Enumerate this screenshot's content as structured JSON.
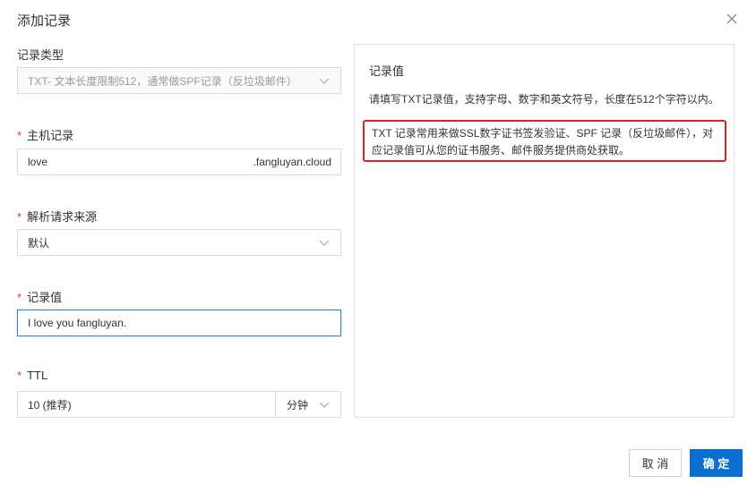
{
  "dialog": {
    "title": "添加记录"
  },
  "form": {
    "record_type": {
      "label": "记录类型",
      "value": "TXT- 文本长度限制512，通常做SPF记录（反垃圾邮件）"
    },
    "host": {
      "label": "主机记录",
      "value": "love",
      "suffix": ".fangluyan.cloud"
    },
    "line": {
      "label": "解析请求来源",
      "value": "默认"
    },
    "record_value": {
      "label": "记录值",
      "value": "I love you fangluyan."
    },
    "ttl": {
      "label": "TTL",
      "value": "10 (推荐)",
      "unit": "分钟"
    }
  },
  "help": {
    "title": "记录值",
    "line1": "请填写TXT记录值，支持字母、数字和英文符号，长度在512个字符以内。",
    "highlight": "TXT 记录常用来做SSL数字证书签发验证、SPF 记录（反垃圾邮件），对应记录值可从您的证书服务、邮件服务提供商处获取。",
    "highlight_color": "#e02020"
  },
  "buttons": {
    "cancel": "取 消",
    "ok": "确 定"
  },
  "colors": {
    "primary": "#0a6fd0",
    "required": "#e23b3b",
    "focus": "#2f88d8"
  },
  "icons": {
    "close": "close-icon",
    "chevron": "chevron-down-icon"
  }
}
